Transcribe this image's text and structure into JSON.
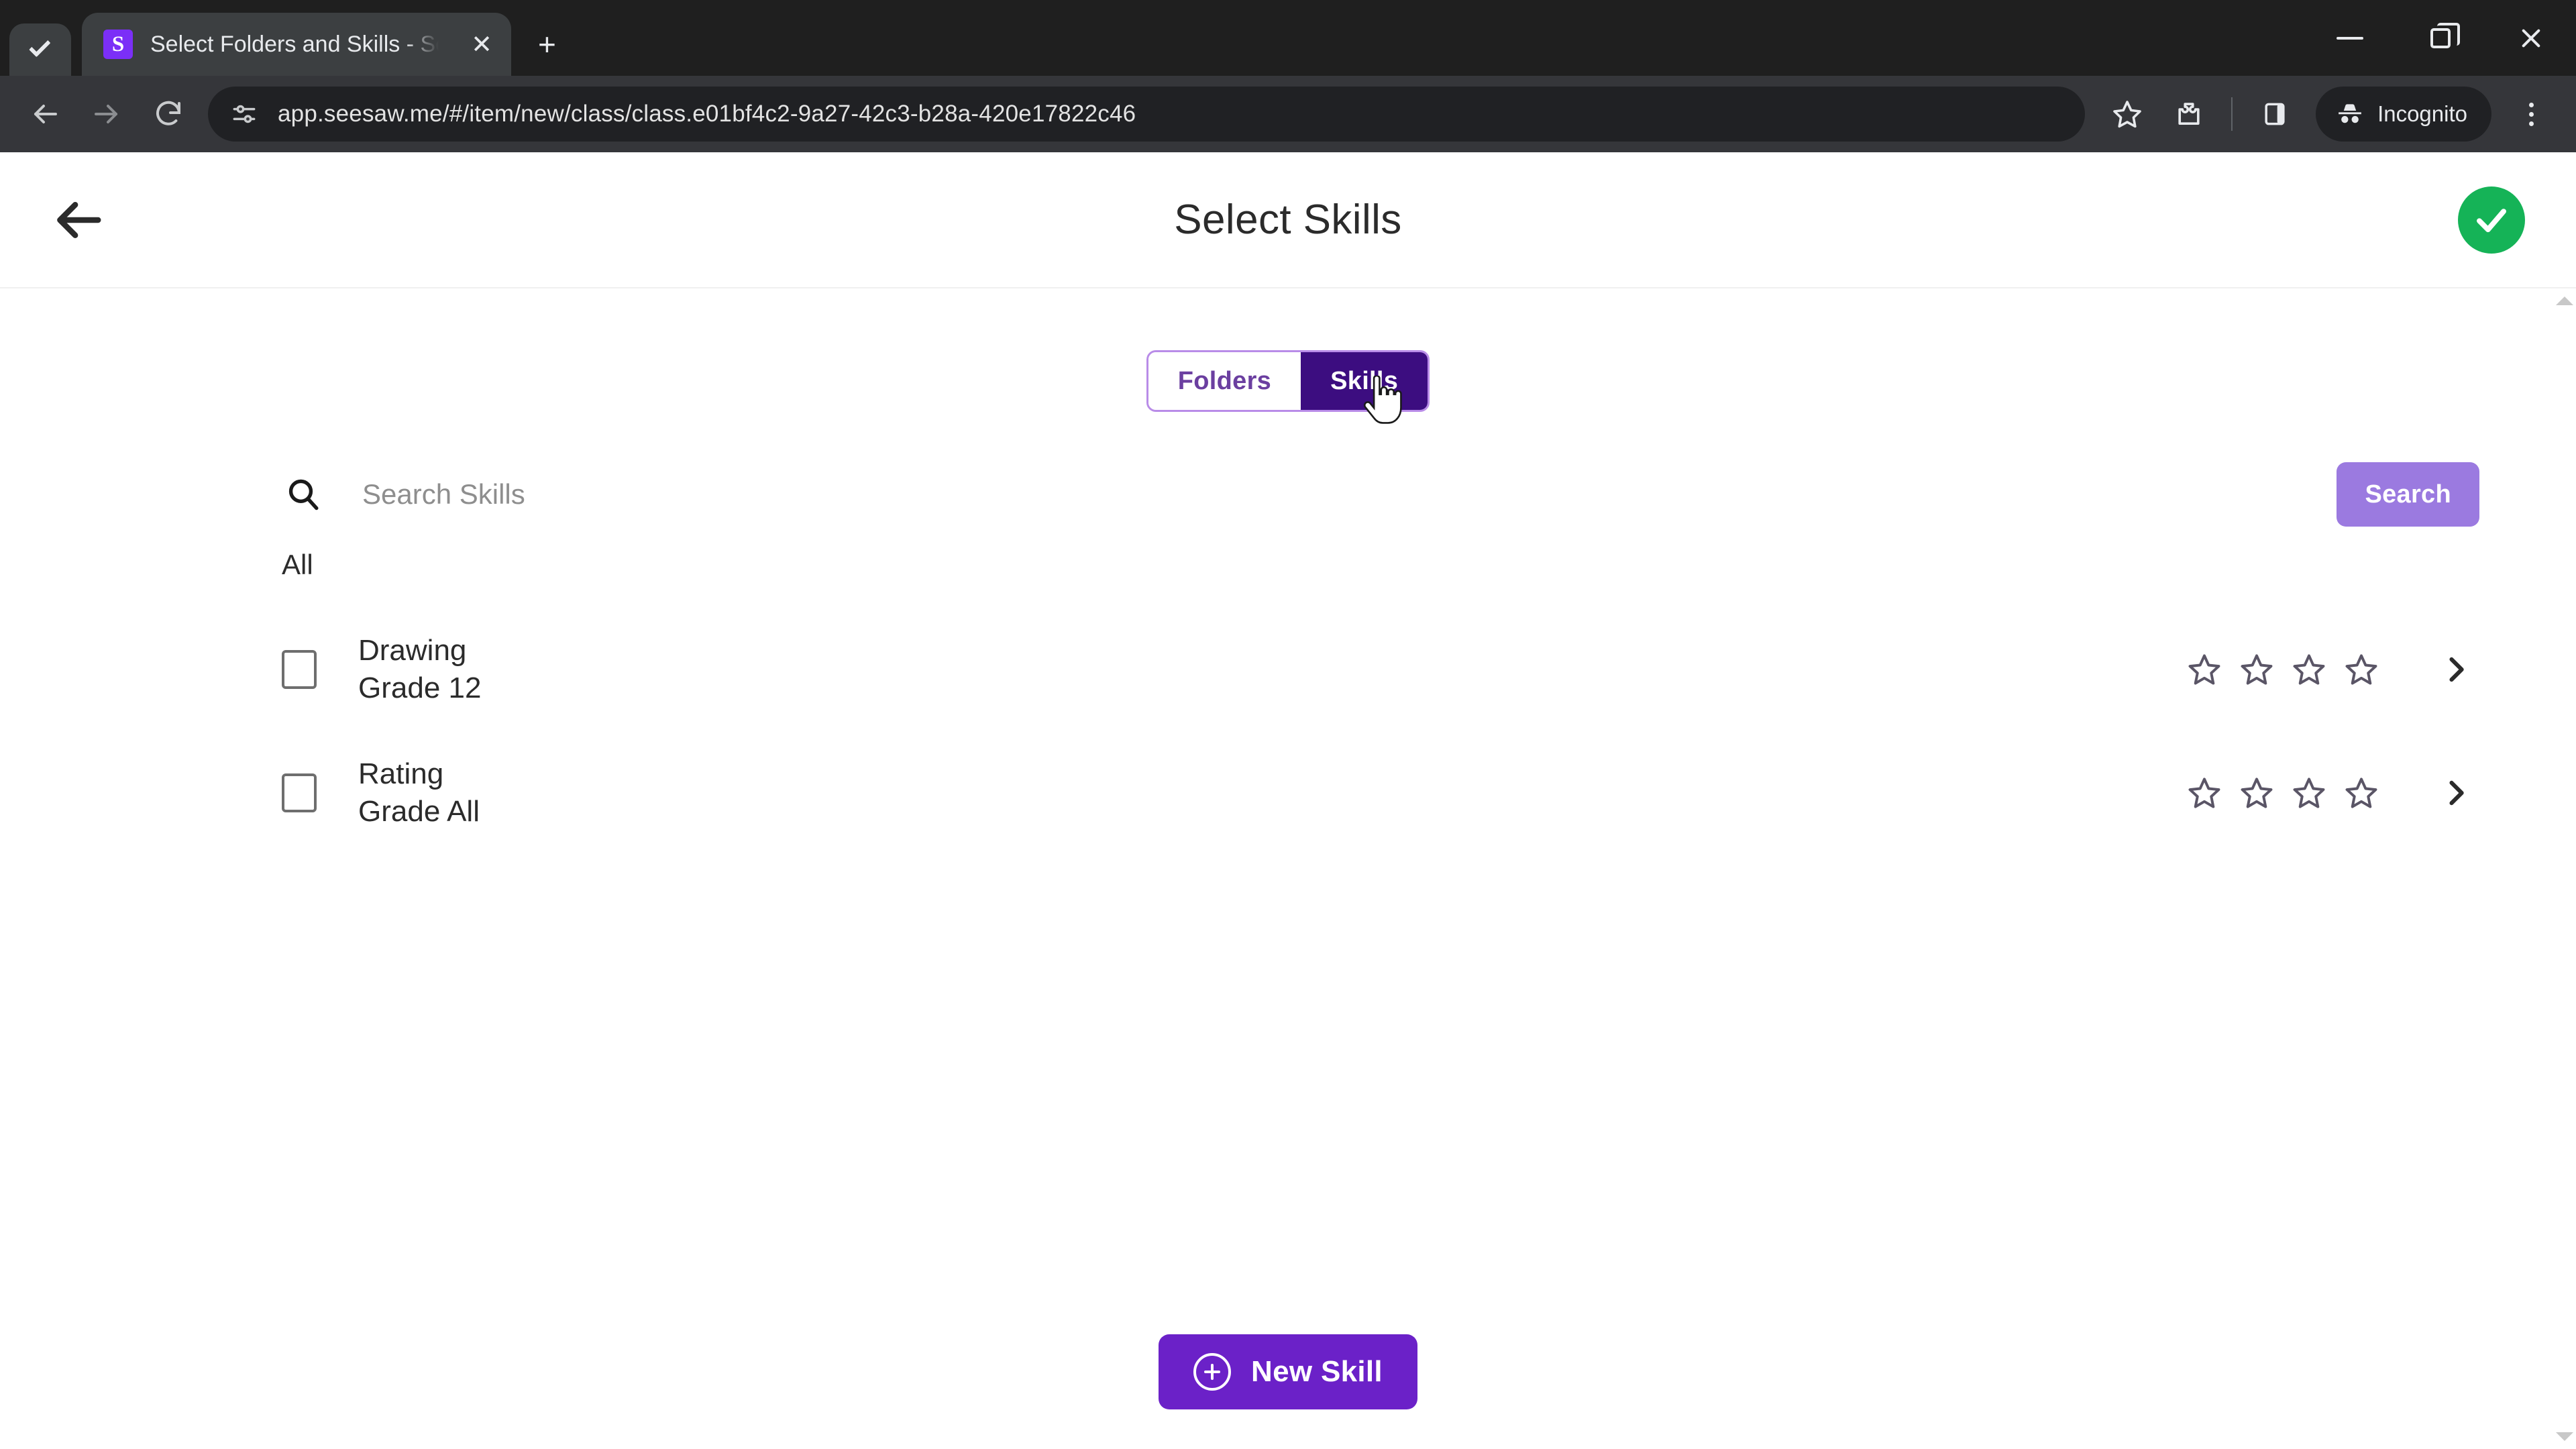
{
  "browser": {
    "tab": {
      "title": "Select Folders and Skills - Seesa",
      "favicon_letter": "S",
      "favicon_color": "#7b2ff7",
      "close_label": "✕"
    },
    "tab_search_icon": "chevron-down-icon",
    "new_tab_label": "+",
    "window": {
      "minimize": "minimize-icon",
      "maximize": "maximize-icon",
      "close": "close-icon"
    },
    "toolbar": {
      "back": "back-icon",
      "forward": "forward-icon",
      "reload": "reload-icon",
      "site_info": "site-settings-icon",
      "url": "app.seesaw.me/#/item/new/class/class.e01bf4c2-9a27-42c3-b28a-420e17822c46",
      "bookmark": "star-icon",
      "extensions": "extensions-icon",
      "side_panel": "side-panel-icon",
      "incognito_label": "Incognito",
      "menu": "kebab-menu-icon"
    }
  },
  "app": {
    "header": {
      "back": "back-arrow-icon",
      "title": "Select Skills",
      "confirm": "check-icon",
      "confirm_color": "#15b357"
    },
    "toggle": {
      "options": [
        {
          "label": "Folders",
          "selected": false
        },
        {
          "label": "Skills",
          "selected": true
        }
      ]
    },
    "search": {
      "icon": "search-icon",
      "value": "",
      "placeholder": "Search Skills",
      "button_label": "Search",
      "button_color": "#9b7ae0"
    },
    "group_label": "All",
    "skills": [
      {
        "name": "Drawing",
        "grade": "Grade 12",
        "checked": false,
        "stars": 4,
        "stars_filled": 0,
        "chevron": "chevron-right-icon"
      },
      {
        "name": "Rating",
        "grade": "Grade All",
        "checked": false,
        "stars": 4,
        "stars_filled": 0,
        "chevron": "chevron-right-icon"
      }
    ],
    "footer": {
      "new_skill_label": "New Skill",
      "new_skill_icon": "plus-circle-icon",
      "new_skill_color": "#6b21c8"
    },
    "cursor": "hand-pointer-cursor"
  }
}
